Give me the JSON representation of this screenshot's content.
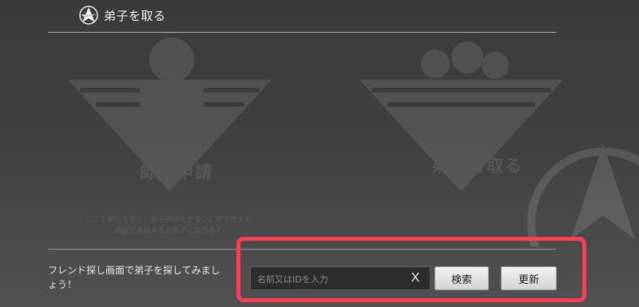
{
  "header": {
    "title": "弟子を取る",
    "emblem_icon": "star-emblem-icon"
  },
  "background_panels": [
    {
      "title": "師匠申請",
      "description_line1": "ここで師匠を探し、弟子申請をすることができます。",
      "description_line2": "師匠が承認すると弟子になります。"
    },
    {
      "title": "弟子を取る"
    }
  ],
  "footer": {
    "helper_text": "フレンド探し画面で弟子を探してみましょう！"
  },
  "search": {
    "placeholder": "名前又はIDを入力",
    "value": "",
    "clear_label": "X",
    "search_label": "検索",
    "refresh_label": "更新"
  },
  "colors": {
    "highlight": "#ff3d57"
  }
}
